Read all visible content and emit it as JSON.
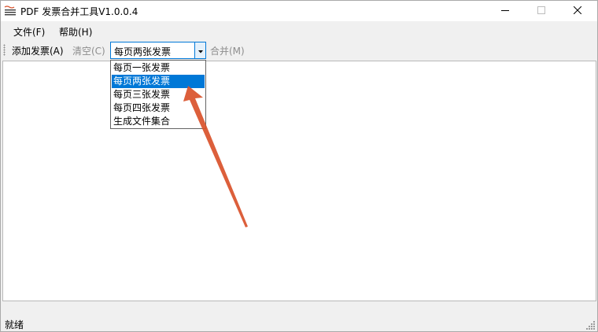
{
  "window": {
    "title": "PDF 发票合并工具V1.0.0.4",
    "accent_color": "#0078d7",
    "annotation_arrow_color": "#d9512a"
  },
  "menu": {
    "file": "文件(F)",
    "help": "帮助(H)"
  },
  "toolbar": {
    "add_invoice": "添加发票(A)",
    "clear": "清空(C)",
    "merge": "合并(M)",
    "mode_combo_value": "每页两张发票"
  },
  "dropdown": {
    "options": [
      "每页一张发票",
      "每页两张发票",
      "每页三张发票",
      "每页四张发票",
      "生成文件集合"
    ],
    "selected_index": 1
  },
  "status": {
    "text": "就绪"
  },
  "icons": {
    "app": "app-icon",
    "minimize": "minimize-icon",
    "maximize": "maximize-icon",
    "close": "close-icon",
    "combo_arrow": "chevron-down-icon",
    "resize": "resize-grip-icon"
  }
}
